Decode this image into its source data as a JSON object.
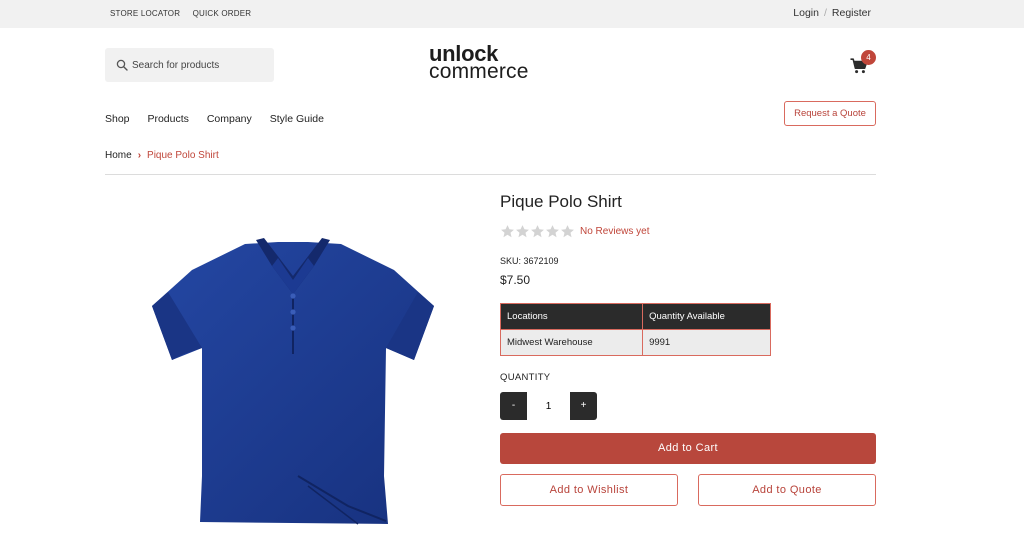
{
  "topbar": {
    "links": [
      "STORE LOCATOR",
      "QUICK ORDER"
    ],
    "login": "Login",
    "separator": "/",
    "register": "Register"
  },
  "search": {
    "placeholder": "Search for products",
    "icon": "search-icon"
  },
  "logo": {
    "line1": "unlock",
    "line2": "commerce"
  },
  "cart": {
    "icon": "cart-icon",
    "count": "4"
  },
  "nav": {
    "items": [
      "Shop",
      "Products",
      "Company",
      "Style Guide"
    ]
  },
  "header": {
    "quote_label": "Request a Quote"
  },
  "breadcrumb": {
    "home": "Home",
    "current": "Pique Polo Shirt"
  },
  "product": {
    "title": "Pique Polo Shirt",
    "rating": 0,
    "rating_max": 5,
    "reviews_text": "No Reviews yet",
    "sku": "SKU: 3672109",
    "price": "$7.50",
    "image_color": "#1f3f94"
  },
  "stock_table": {
    "headers": [
      "Locations",
      "Quantity Available"
    ],
    "rows": [
      [
        "Midwest Warehouse",
        "9991"
      ]
    ]
  },
  "quantity": {
    "label": "QUANTITY",
    "minus": "-",
    "value": "1",
    "plus": "+"
  },
  "actions": {
    "add_to_cart": "Add to Cart",
    "add_to_wishlist": "Add to Wishlist",
    "add_to_quote": "Add to Quote"
  },
  "colors": {
    "accent": "#b8473c",
    "dark": "#2b2b2b",
    "topbar": "#f1f1f1"
  }
}
